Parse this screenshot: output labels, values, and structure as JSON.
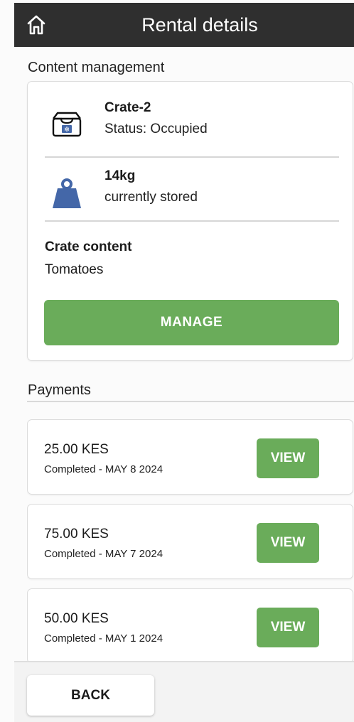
{
  "header": {
    "title": "Rental details",
    "home_icon": "home-icon"
  },
  "content_section": {
    "label": "Content management",
    "crate": {
      "name": "Crate-2",
      "status": "Status: Occupied",
      "icon": "crate-icon"
    },
    "weight": {
      "value": "14kg",
      "caption": "currently stored",
      "icon": "weight-icon",
      "icon_color": "#4467a8"
    },
    "content_title": "Crate content",
    "content_value": "Tomatoes",
    "manage_label": "MANAGE"
  },
  "payments_section": {
    "label": "Payments",
    "items": [
      {
        "amount": "25.00 KES",
        "status": "Completed - MAY 8 2024",
        "view_label": "VIEW"
      },
      {
        "amount": "75.00 KES",
        "status": "Completed - MAY 7 2024",
        "view_label": "VIEW"
      },
      {
        "amount": "50.00 KES",
        "status": "Completed - MAY 1 2024",
        "view_label": "VIEW"
      }
    ]
  },
  "footer": {
    "back_label": "BACK"
  },
  "colors": {
    "accent_green": "#6aac5a",
    "appbar": "#2f2f2f"
  }
}
